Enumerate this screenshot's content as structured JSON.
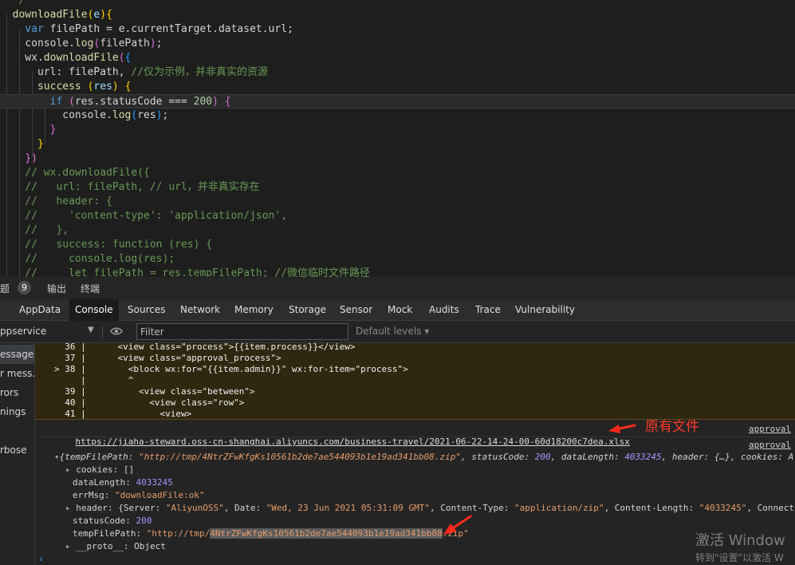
{
  "editor": {
    "lines": [
      [
        {
          "t": "  */",
          "c": "c-cmt"
        }
      ],
      [
        {
          "t": "  downloadFile",
          "c": "c-fn"
        },
        {
          "t": "(",
          "c": "c-br1"
        },
        {
          "t": "e",
          "c": "c-var"
        },
        {
          "t": ")",
          "c": "c-br1"
        },
        {
          "t": "{",
          "c": "c-br1"
        }
      ],
      [
        {
          "t": "    ",
          "c": "c-txt"
        },
        {
          "t": "var",
          "c": "c-kw"
        },
        {
          "t": " filePath = e.currentTarget.dataset.url;",
          "c": "c-txt"
        }
      ],
      [
        {
          "t": "    console.",
          "c": "c-txt"
        },
        {
          "t": "log",
          "c": "c-fn"
        },
        {
          "t": "(",
          "c": "c-br2"
        },
        {
          "t": "filePath",
          "c": "c-txt"
        },
        {
          "t": ")",
          "c": "c-br2"
        },
        {
          "t": ";",
          "c": "c-txt"
        }
      ],
      [
        {
          "t": "    wx.",
          "c": "c-txt"
        },
        {
          "t": "downloadFile",
          "c": "c-fn"
        },
        {
          "t": "(",
          "c": "c-br2"
        },
        {
          "t": "{",
          "c": "c-br3"
        }
      ],
      [
        {
          "t": "      url: filePath, ",
          "c": "c-txt"
        },
        {
          "t": "//仅为示例，并非真实的资源",
          "c": "c-cmt"
        }
      ],
      [
        {
          "t": "      ",
          "c": "c-txt"
        },
        {
          "t": "success",
          "c": "c-fn"
        },
        {
          "t": " ",
          "c": "c-txt"
        },
        {
          "t": "(",
          "c": "c-br1"
        },
        {
          "t": "res",
          "c": "c-var"
        },
        {
          "t": ")",
          "c": "c-br1"
        },
        {
          "t": " ",
          "c": "c-txt"
        },
        {
          "t": "{",
          "c": "c-br1"
        }
      ],
      [
        {
          "t": "        ",
          "c": "c-txt"
        },
        {
          "t": "if",
          "c": "c-kw"
        },
        {
          "t": " ",
          "c": "c-txt"
        },
        {
          "t": "(",
          "c": "c-br2"
        },
        {
          "t": "res.statusCode === ",
          "c": "c-txt"
        },
        {
          "t": "200",
          "c": "c-num"
        },
        {
          "t": ")",
          "c": "c-br2"
        },
        {
          "t": " ",
          "c": "c-txt"
        },
        {
          "t": "{",
          "c": "c-br2"
        }
      ],
      [
        {
          "t": "          console.",
          "c": "c-txt"
        },
        {
          "t": "log",
          "c": "c-fn"
        },
        {
          "t": "(",
          "c": "c-br3"
        },
        {
          "t": "res",
          "c": "c-txt"
        },
        {
          "t": ")",
          "c": "c-br3"
        },
        {
          "t": ";",
          "c": "c-txt"
        }
      ],
      [
        {
          "t": "        ",
          "c": "c-txt"
        },
        {
          "t": "}",
          "c": "c-br2"
        }
      ],
      [
        {
          "t": "      ",
          "c": "c-txt"
        },
        {
          "t": "}",
          "c": "c-br1"
        }
      ],
      [
        {
          "t": "    ",
          "c": "c-txt"
        },
        {
          "t": "})",
          "c": "c-br2"
        }
      ],
      [
        {
          "t": "    // wx.downloadFile({",
          "c": "c-cmt"
        }
      ],
      [
        {
          "t": "    //   url: filePath, // url，并非真实存在",
          "c": "c-cmt"
        }
      ],
      [
        {
          "t": "    //   header: {",
          "c": "c-cmt"
        }
      ],
      [
        {
          "t": "    //     'content-type': 'application/json',",
          "c": "c-cmt"
        }
      ],
      [
        {
          "t": "    //   },",
          "c": "c-cmt"
        }
      ],
      [
        {
          "t": "    //   success: function (res) {",
          "c": "c-cmt"
        }
      ],
      [
        {
          "t": "    //     console.log(res);",
          "c": "c-cmt"
        }
      ],
      [
        {
          "t": "    //     let filePath = res.tempFilePath; //微信临时文件路径",
          "c": "c-cmt"
        }
      ]
    ]
  },
  "panel": {
    "problems_label": "题",
    "problems_count": "9",
    "output_label": "输出",
    "terminal_label": "终端"
  },
  "devtools": {
    "tabs": [
      "AppData",
      "Console",
      "Sources",
      "Network",
      "Memory",
      "Storage",
      "Sensor",
      "Mock",
      "Audits",
      "Trace",
      "Vulnerability"
    ],
    "active_tab": "Console"
  },
  "toolbar": {
    "context": "ppservice",
    "filter_placeholder": "Filter",
    "levels": "Default levels ▾"
  },
  "sidebar": {
    "items": [
      "essages",
      "r mess...",
      "rors",
      "nings",
      "rbose"
    ]
  },
  "console": {
    "error_source": [
      {
        "num": "36",
        "mark": " ",
        "code": "    <view class=\"process\">{{item.process}}</view>"
      },
      {
        "num": "37",
        "mark": " ",
        "code": "    <view class=\"approval_process\">"
      },
      {
        "num": "38",
        "mark": ">",
        "code": "      <block wx:for=\"{{item.admin}}\" wx:for-item=\"process\">"
      },
      {
        "num": "",
        "mark": " ",
        "code": "      ^"
      },
      {
        "num": "39",
        "mark": " ",
        "code": "        <view class=\"between\">"
      },
      {
        "num": "40",
        "mark": " ",
        "code": "          <view class=\"row\">"
      },
      {
        "num": "41",
        "mark": " ",
        "code": "            <view>"
      }
    ],
    "log_url": "https://jiaha-steward.oss-cn-shanghai.aliyuncs.com/business-travel/2021-06-22-14-24-00-60d18200c7dea.xlsx",
    "source_link_1": "approval",
    "source_link_2": "approval",
    "annotation": "原有文件",
    "object_summary": {
      "prefix": "{",
      "k1": "tempFilePath",
      "v1": "\"http://tmp/4NtrZFwKfgKs10561b2de7ae544093b1e19ad341bb08.zip\"",
      "k2": "statusCode",
      "v2": "200",
      "k3": "dataLength",
      "v3": "4033245",
      "k4": "header",
      "v4": "{…}",
      "k5": "cookies",
      "v5": "A"
    },
    "props": {
      "cookies": "[]",
      "dataLength": "4033245",
      "errMsg": "\"downloadFile:ok\"",
      "header_server": "\"AliyunOSS\"",
      "header_date": "\"Wed, 23 Jun 2021 05:31:09 GMT\"",
      "header_ctype": "\"application/zip\"",
      "header_clen": "\"4033245\"",
      "header_more": "Connecti",
      "statusCode": "200",
      "temp_prefix": "\"http://tmp/",
      "temp_sel": "4NtrZFwKfgKs10561b2de7ae544093b1e19ad341bb08",
      "temp_suffix": ".zip\"",
      "proto": "Object"
    }
  },
  "watermark": {
    "line1": "激活 Window",
    "line2": "转到\"设置\"以激活 W"
  },
  "colors": {
    "editor_bg": "#1e1e1e",
    "warning_bg": "#2f2710",
    "annotation_red": "#ff3a2a",
    "string": "#e59c6b",
    "number": "#9e99ff"
  }
}
